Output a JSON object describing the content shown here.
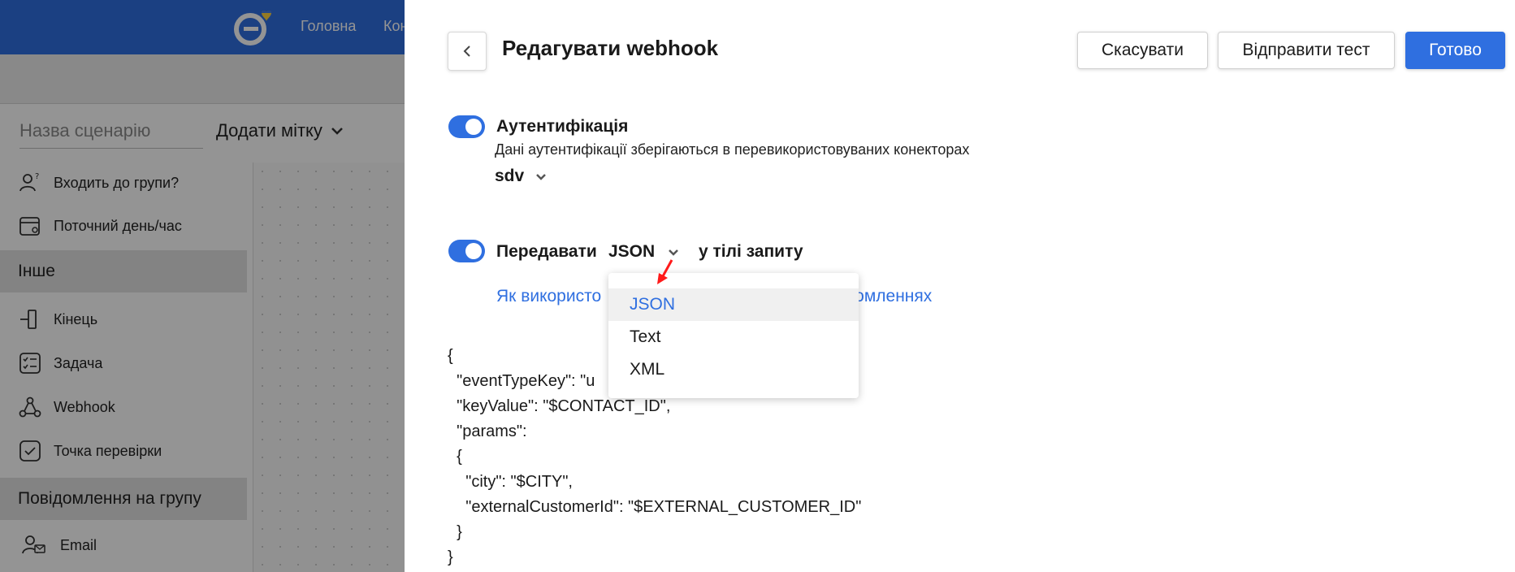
{
  "background": {
    "nav": [
      "Головна",
      "Кон"
    ],
    "scenario_name_placeholder": "Назва сценарію",
    "add_tag_label": "Додати мітку",
    "items_top": [
      {
        "label": "Входить до групи?",
        "icon": "users-question-icon"
      },
      {
        "label": "Поточний день/час",
        "icon": "calendar-clock-icon"
      }
    ],
    "section_other": "Інше",
    "items_other": [
      {
        "label": "Кінець",
        "icon": "end-icon"
      },
      {
        "label": "Задача",
        "icon": "task-list-icon"
      },
      {
        "label": "Webhook",
        "icon": "webhook-icon"
      },
      {
        "label": "Точка перевірки",
        "icon": "checkpoint-icon"
      }
    ],
    "section_group": "Повідомлення на групу",
    "items_group": [
      {
        "label": "Email",
        "icon": "users-email-icon"
      }
    ]
  },
  "panel": {
    "title": "Редагувати webhook",
    "buttons": {
      "cancel": "Скасувати",
      "send_test": "Відправити тест",
      "done": "Готово"
    },
    "auth": {
      "label": "Аутентифікація",
      "enabled": true,
      "description": "Дані аутентифікації зберігаються в перевикористовуваних конекторах",
      "selected": "sdv"
    },
    "body": {
      "prefix": "Передавати",
      "format": "JSON",
      "suffix": "у тілі запиту",
      "enabled": true,
      "help_link_start": "Як використо",
      "help_link_end": "омленнях"
    },
    "format_options": [
      "JSON",
      "Text",
      "XML"
    ],
    "selected_option_index": 0,
    "code_lines": [
      "{",
      "  \"eventTypeKey\": \"u",
      "  \"keyValue\": \"$CONTACT_ID\",",
      "  \"params\":",
      "  {",
      "    \"city\": \"$CITY\",",
      "    \"externalCustomerId\": \"$EXTERNAL_CUSTOMER_ID\"",
      "  }",
      "}"
    ]
  },
  "colors": {
    "accent": "#2f6fe0",
    "pointer": "#ff1a1a"
  }
}
